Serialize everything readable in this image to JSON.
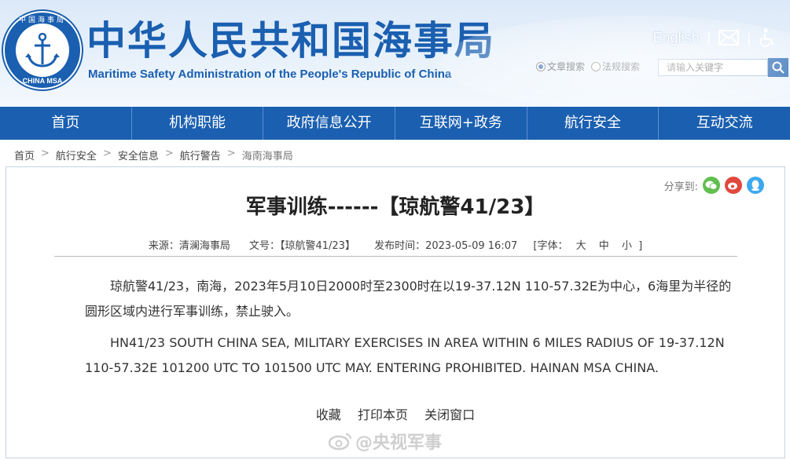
{
  "header": {
    "logo": {
      "top_text": "中国海事局",
      "bottom_text": "CHINA MSA"
    },
    "title": "中华人民共和国海事局",
    "subtitle": "Maritime Safety Administration of the People's Republic of China",
    "english_link": "English",
    "separator": "|",
    "search": {
      "radio_1": "文章搜索",
      "radio_2": "法规搜索",
      "placeholder": "请输入关键字"
    }
  },
  "nav": {
    "items": [
      "首页",
      "机构职能",
      "政府信息公开",
      "互联网+政务",
      "航行安全",
      "互动交流"
    ]
  },
  "breadcrumb": {
    "items": [
      "首页",
      "航行安全",
      "安全信息",
      "航行警告",
      "海南海事局"
    ],
    "arrow": ">"
  },
  "article": {
    "share_label": "分享到:",
    "title": "军事训练------【琼航警41/23】",
    "source": "来源：清澜海事局",
    "doc_no": "文号：【琼航警41/23】",
    "publish_time": "发布时间：2023-05-09 16:07",
    "font_label": "[字体：",
    "font_large": "大",
    "font_medium": "中",
    "font_small": "小",
    "font_close": "]",
    "para_cn": "琼航警41/23，南海，2023年5月10日2000时至2300时在以19-37.12N 110-57.32E为中心，6海里为半径的圆形区域内进行军事训练，禁止驶入。",
    "para_en": "HN41/23 SOUTH CHINA SEA, MILITARY EXERCISES IN AREA WITHIN 6 MILES RADIUS OF 19-37.12N 110-57.32E 101200 UTC TO 101500 UTC MAY. ENTERING PROHIBITED. HAINAN MSA CHINA.",
    "action_favorite": "收藏",
    "action_print": "打印本页",
    "action_close": "关闭窗口"
  },
  "watermark": "@央视军事",
  "colors": {
    "brand_blue": "#1a5fb0",
    "wechat": "#5fbf4f",
    "weibo": "#e0483d",
    "qq": "#3ca8f0"
  }
}
